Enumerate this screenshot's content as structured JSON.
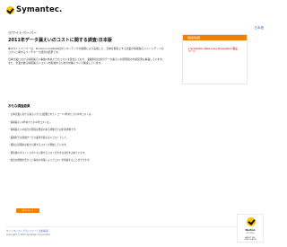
{
  "brand": {
    "name": "Symantec."
  },
  "header": {
    "right_link": "日本語"
  },
  "main": {
    "kicker": "ホワイトペーパー",
    "title": "2011年データ漏えいのコストに関する調査:日本版",
    "paragraph_1": "本ホワイトペーパーは、Ponemon Institute社がシマンテックの依頼により実施した、日本を拠点とする企業の情報漏えいインシデントのコストに関するベンチマーク調査の結果です。",
    "paragraph_2": "日本企業における情報漏えい事故1件あたりのコストを算出しており、業種別の比較やデータ漏えいの原因別の分析結果も掲載しています。また、企業が被る情報漏えいコストを削減するための対策について解説しています。",
    "section_title": "おもな調査結果",
    "bullets": [
      "・日本企業における漏えいまたは盗難されたレコード1件あたりの平均コストは...",
      "・情報漏えい1件あたりの平均コストは...",
      "・情報漏えいの最大の原因は悪意のある攻撃または犯罪攻撃です。",
      "・業種別では金融サービス業界が最も高いコストでした。",
      "・検知と段階的な拡大に関するコストが増加しています。",
      "・発生後のポストレスポンスに関するコストが大きな割合を占めています。",
      "・過去の経験を活かした事前の対策によってコストを削減することができます。"
    ],
    "button_label": "ダウンロード"
  },
  "sidebar": {
    "header": "【関連情報】",
    "link": "Symantec Data Loss Prevention 製品ページ"
  },
  "footer": {
    "links": "サイトマップ | プライバシー | 法的事項",
    "copyright": "Copyright © 2012 Symantec Corporation"
  },
  "badge": {
    "title": "Norton",
    "subtitle": "SECURED",
    "bottom": "ABOUT SSL CERTIFICATES"
  }
}
